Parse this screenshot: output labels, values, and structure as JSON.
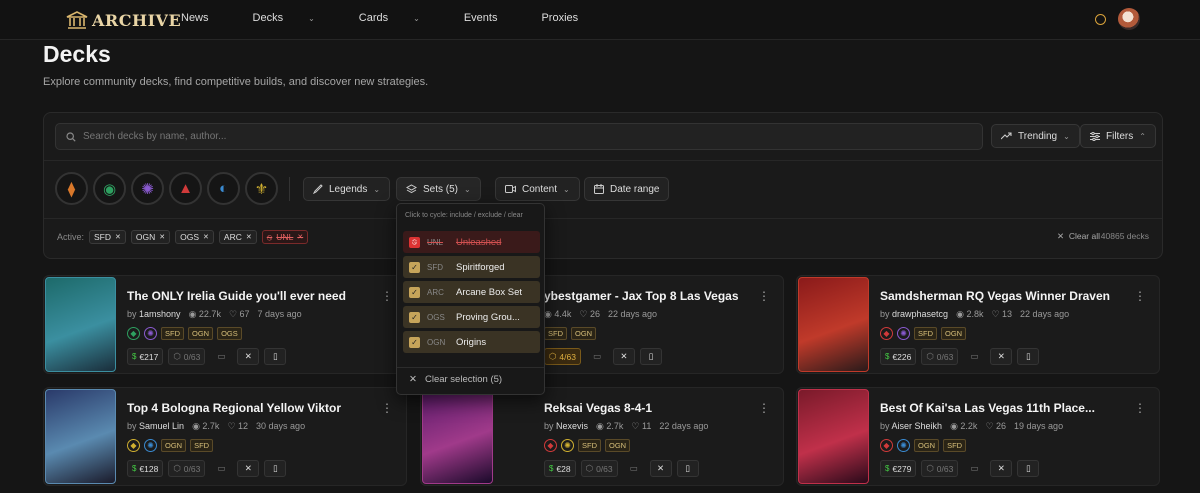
{
  "nav": {
    "brand": "ARCHIVE",
    "links": [
      {
        "label": "News",
        "has_dropdown": false
      },
      {
        "label": "Decks",
        "has_dropdown": true
      },
      {
        "label": "Cards",
        "has_dropdown": true
      },
      {
        "label": "Events",
        "has_dropdown": false
      },
      {
        "label": "Proxies",
        "has_dropdown": false
      }
    ]
  },
  "page": {
    "title": "Decks",
    "subtitle": "Explore community decks, find competitive builds, and discover new strategies."
  },
  "filters": {
    "search_placeholder": "Search decks by name, author...",
    "sort_label": "Trending",
    "filters_label": "Filters",
    "legends_label": "Legends",
    "sets_label": "Sets (5)",
    "content_label": "Content",
    "date_label": "Date range",
    "domain_icons": [
      "fury-icon",
      "calm-icon",
      "mind-icon",
      "body-icon",
      "chaos-icon",
      "order-icon"
    ],
    "active_label": "Active:",
    "active_chips": [
      {
        "label": "SFD",
        "excluded": false
      },
      {
        "label": "OGN",
        "excluded": false
      },
      {
        "label": "OGS",
        "excluded": false
      },
      {
        "label": "ARC",
        "excluded": false
      },
      {
        "label": "UNL",
        "excluded": true
      }
    ],
    "clear_all": "Clear all",
    "deck_count": "40865 decks"
  },
  "sets_dropdown": {
    "hint": "Click to cycle: include / exclude / clear",
    "items": [
      {
        "code": "UNL",
        "name": "Unleashed",
        "state": "exclude"
      },
      {
        "code": "SFD",
        "name": "Spiritforged",
        "state": "include"
      },
      {
        "code": "ARC",
        "name": "Arcane Box Set",
        "state": "include"
      },
      {
        "code": "OGS",
        "name": "Proving Grou...",
        "state": "include"
      },
      {
        "code": "OGN",
        "name": "Origins",
        "state": "include"
      }
    ],
    "clear_label": "Clear selection (5)"
  },
  "decks": [
    {
      "title": "The ONLY Irelia Guide you'll ever need",
      "by": "by",
      "author": "1amshony",
      "views": "22.7k",
      "likes": "67",
      "age": "7 days ago",
      "tags": [
        "SFD",
        "OGN",
        "OGS"
      ],
      "price": "€217",
      "owned": "0/63",
      "art": [
        "#1d6a6a",
        "#3b8fa0",
        "#1a2d3a"
      ]
    },
    {
      "title": "ybestgamer - Jax Top 8 Las Vegas",
      "by": "",
      "author": "",
      "views": "4.4k",
      "likes": "26",
      "age": "22 days ago",
      "tags": [
        "SFD",
        "OGN"
      ],
      "price": "",
      "owned": "4/63",
      "art": [
        "#4a2a5a",
        "#7a3a6a",
        "#2a1a2a"
      ]
    },
    {
      "title": "Samdsherman RQ Vegas Winner Draven",
      "by": "by",
      "author": "drawphasetcg",
      "views": "2.8k",
      "likes": "13",
      "age": "22 days ago",
      "tags": [
        "SFD",
        "OGN"
      ],
      "price": "€226",
      "owned": "0/63",
      "art": [
        "#8a1a1a",
        "#c03a2a",
        "#2a1a1a"
      ]
    },
    {
      "title": "Top 4 Bologna Regional Yellow Viktor",
      "by": "by",
      "author": "Samuel Lin",
      "views": "2.7k",
      "likes": "12",
      "age": "30 days ago",
      "tags": [
        "OGN",
        "SFD"
      ],
      "price": "€128",
      "owned": "0/63",
      "art": [
        "#2a3a6a",
        "#5a8ab0",
        "#1a1a2a"
      ]
    },
    {
      "title": "Reksai Vegas 8-4-1",
      "by": "by",
      "author": "Nexevis",
      "views": "2.7k",
      "likes": "11",
      "age": "22 days ago",
      "tags": [
        "SFD",
        "OGN"
      ],
      "price": "€28",
      "owned": "0/63",
      "art": [
        "#5a1a6a",
        "#a03a8a",
        "#1a0a2a"
      ]
    },
    {
      "title": "Best Of Kai'sa Las Vegas 11th Place...",
      "by": "by",
      "author": "Aiser Sheikh",
      "views": "2.2k",
      "likes": "26",
      "age": "19 days ago",
      "tags": [
        "OGN",
        "SFD"
      ],
      "price": "€279",
      "owned": "0/63",
      "art": [
        "#7a1a2a",
        "#c0304a",
        "#2a0a1a"
      ]
    }
  ],
  "colors": {
    "accent": "#c6a45a",
    "exclude": "#d33333",
    "bg": "#151515"
  }
}
